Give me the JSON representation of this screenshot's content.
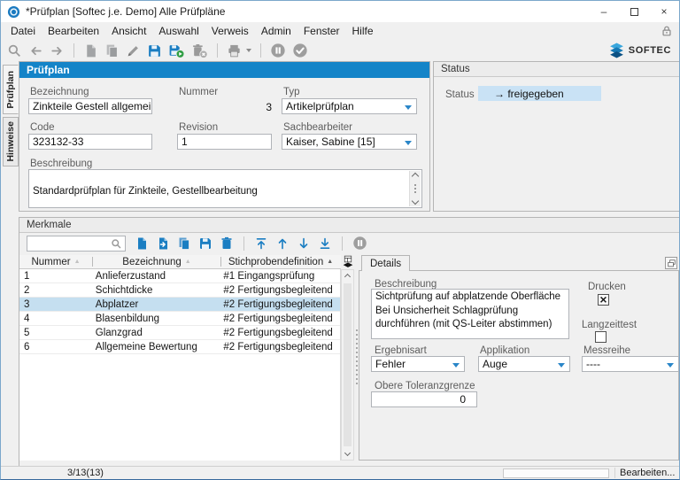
{
  "window": {
    "title": "*Prüfplan [Softec j.e. Demo] Alle Prüfpläne"
  },
  "brand": {
    "name": "SOFTEC"
  },
  "menu": {
    "items": [
      "Datei",
      "Bearbeiten",
      "Ansicht",
      "Auswahl",
      "Verweis",
      "Admin",
      "Fenster",
      "Hilfe"
    ]
  },
  "main_toolbar": {
    "icons": [
      "search",
      "back",
      "forward",
      "new-document",
      "copy-document",
      "edit-pencil",
      "save",
      "save-activate",
      "delete",
      "print",
      "pause",
      "complete"
    ]
  },
  "side_tabs": {
    "tab1": "Prüfplan",
    "tab2": "Hinweise"
  },
  "pruefplan": {
    "header": "Prüfplan",
    "bezeichnung": {
      "label": "Bezeichnung",
      "value": "Zinkteile Gestell allgemein"
    },
    "nummer": {
      "label": "Nummer",
      "value": "3"
    },
    "typ": {
      "label": "Typ",
      "value": "Artikelprüfplan"
    },
    "code": {
      "label": "Code",
      "value": "323132-33"
    },
    "revision": {
      "label": "Revision",
      "value": "1"
    },
    "sachbearbeiter": {
      "label": "Sachbearbeiter",
      "value": "Kaiser, Sabine [15]"
    },
    "beschreibung": {
      "label": "Beschreibung",
      "value": "Standardprüfplan für Zinkteile, Gestellbearbeitung"
    }
  },
  "status_panel": {
    "header": "Status",
    "label": "Status",
    "value": "→ freigegeben"
  },
  "merkmale": {
    "header": "Merkmale",
    "search_value": "",
    "toolbar_icons": [
      "new-row",
      "insert-row",
      "copy-row",
      "save-row",
      "delete-row",
      "move-first",
      "move-up",
      "move-down",
      "move-last",
      "pause"
    ],
    "table": {
      "columns": [
        {
          "label": "Nummer"
        },
        {
          "label": "Bezeichnung"
        },
        {
          "label": "Stichprobendefinition"
        }
      ],
      "sorted_column": 2,
      "selected_row": 2,
      "rows": [
        {
          "nummer": "1",
          "bezeichnung": "Anlieferzustand",
          "stichprobe": "#1 Eingangsprüfung"
        },
        {
          "nummer": "2",
          "bezeichnung": "Schichtdicke",
          "stichprobe": "#2 Fertigungsbegleitend"
        },
        {
          "nummer": "3",
          "bezeichnung": "Abplatzer",
          "stichprobe": "#2 Fertigungsbegleitend"
        },
        {
          "nummer": "4",
          "bezeichnung": "Blasenbildung",
          "stichprobe": "#2 Fertigungsbegleitend"
        },
        {
          "nummer": "5",
          "bezeichnung": "Glanzgrad",
          "stichprobe": "#2 Fertigungsbegleitend"
        },
        {
          "nummer": "6",
          "bezeichnung": "Allgemeine Bewertung",
          "stichprobe": "#2 Fertigungsbegleitend"
        }
      ]
    },
    "details": {
      "tab": "Details",
      "beschreibung": {
        "label": "Beschreibung",
        "value": "Sichtprüfung auf abplatzende Oberfläche\nBei Unsicherheit Schlagprüfung durchführen (mit QS-Leiter abstimmen)"
      },
      "drucken": {
        "label": "Drucken",
        "checked": true
      },
      "langzeittest": {
        "label": "Langzeittest",
        "checked": false
      },
      "ergebnisart": {
        "label": "Ergebnisart",
        "value": "Fehler"
      },
      "applikation": {
        "label": "Applikation",
        "value": "Auge"
      },
      "messreihe": {
        "label": "Messreihe",
        "value": "----"
      },
      "obere_toleranzgrenze": {
        "label": "Obere Toleranzgrenze",
        "value": "0"
      }
    }
  },
  "statusbar": {
    "position": "3/13(13)",
    "mode": "Bearbeiten..."
  }
}
